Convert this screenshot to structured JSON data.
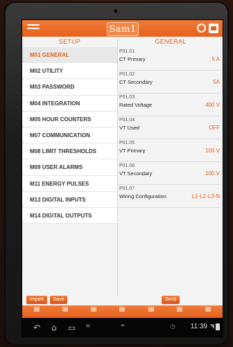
{
  "app": {
    "logo_text": "Sam1",
    "brand_color": "#e5611d"
  },
  "headers": {
    "left": "SETUP",
    "right": "GENERAL"
  },
  "menu": [
    {
      "label": "M01 GENERAL",
      "active": true
    },
    {
      "label": "M02 UTILITY"
    },
    {
      "label": "M03 PASSWORD"
    },
    {
      "label": "M04 INTEGRATION"
    },
    {
      "label": "M05 HOUR COUNTERS"
    },
    {
      "label": "M07 COMMUNICATION"
    },
    {
      "label": "M08 LIMIT THRESHOLDS"
    },
    {
      "label": "M09 USER ALARMS"
    },
    {
      "label": "M11 ENERGY PULSES"
    },
    {
      "label": "M13 DIGITAL INPUTS"
    },
    {
      "label": "M14 DIGITAL OUTPUTS"
    }
  ],
  "params": [
    {
      "code": "P01.01",
      "name": "CT Primary",
      "value": "5 A"
    },
    {
      "code": "P01.02",
      "name": "CT Secondary",
      "value": "5A"
    },
    {
      "code": "P01.03",
      "name": "Rated Voltage",
      "value": "400 V"
    },
    {
      "code": "P01.04",
      "name": "VT Used",
      "value": "OFF"
    },
    {
      "code": "P01.05",
      "name": "VT Primary",
      "value": "100 V"
    },
    {
      "code": "P01.06",
      "name": "VT Secondary",
      "value": "100 V"
    },
    {
      "code": "P01.07",
      "name": "Wiring Configuration",
      "value": "L1-L2-L3-N"
    }
  ],
  "buttons": {
    "import": "Import",
    "save": "Save",
    "send": "Send"
  },
  "bottom_nav": [
    {
      "icon": "home-icon"
    },
    {
      "icon": "device-icon"
    },
    {
      "icon": "measure-icon"
    },
    {
      "icon": "chart-icon"
    },
    {
      "icon": "settings-icon"
    },
    {
      "icon": "info-icon"
    },
    {
      "icon": "exit-icon"
    }
  ],
  "system_bar": {
    "clock": "11:39"
  }
}
